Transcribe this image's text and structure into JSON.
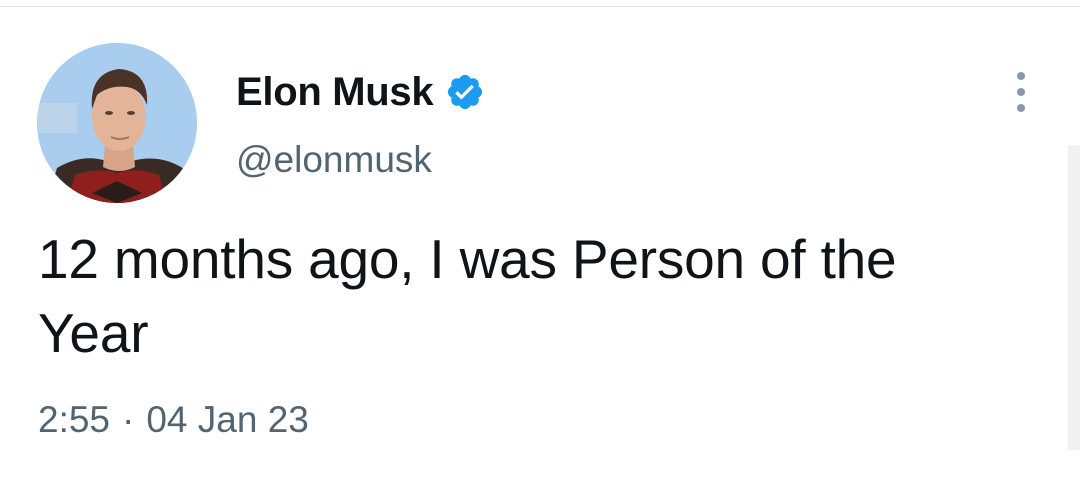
{
  "tweet": {
    "author": {
      "display_name": "Elon Musk",
      "handle": "@elonmusk",
      "verified": true,
      "verified_icon": "verified-badge-icon"
    },
    "text": "12 months ago, I was Person of the Year",
    "time": "2:55",
    "separator": "·",
    "date": "04 Jan 23",
    "more_icon": "more-dots-vertical-icon"
  },
  "colors": {
    "text_primary": "#0f1419",
    "text_secondary": "#536471",
    "verified_blue": "#1d9bf0",
    "background": "#ffffff"
  }
}
